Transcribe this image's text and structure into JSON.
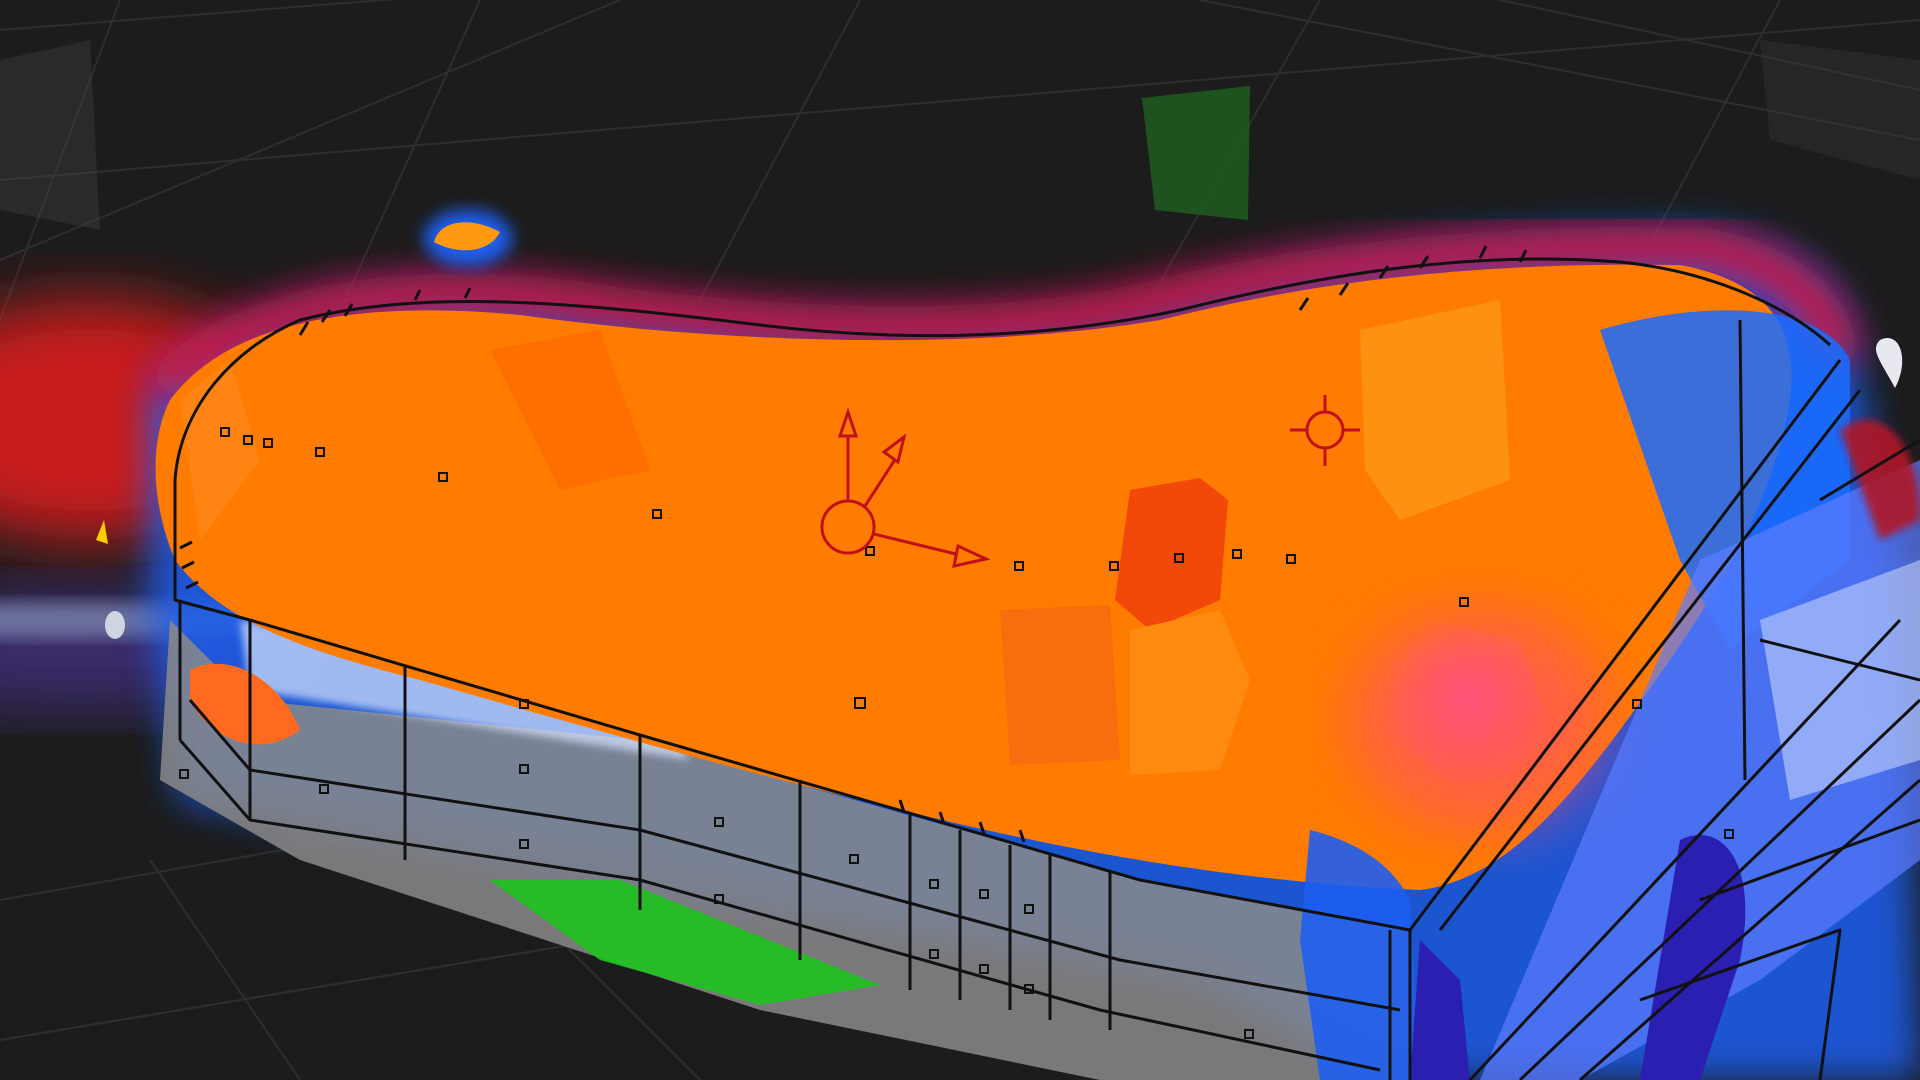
{
  "viewport": {
    "view_type": "3d-viewport",
    "background_color": "#1c1c1c",
    "grid_color": "#3a3a3a"
  },
  "scene": {
    "object": "wireframe-mesh-with-heatmap-overlay",
    "heatmap_colors": {
      "hot": "#ff7a00",
      "warm": "#ff4a00",
      "edge": "#d8102a",
      "cool": "#1e6dff",
      "cold": "#2a1fb0",
      "neutral": "#8a8a8a",
      "accent_green": "#1fc21f",
      "pale": "#d9e6ff"
    },
    "wire_color": "#111111"
  },
  "gizmos": {
    "transform_gizmo": {
      "icon": "object-origin-axes-icon",
      "color": "#c0101a"
    },
    "cursor_3d": {
      "icon": "3d-cursor-crosshair-icon",
      "color": "#c0101a"
    }
  }
}
